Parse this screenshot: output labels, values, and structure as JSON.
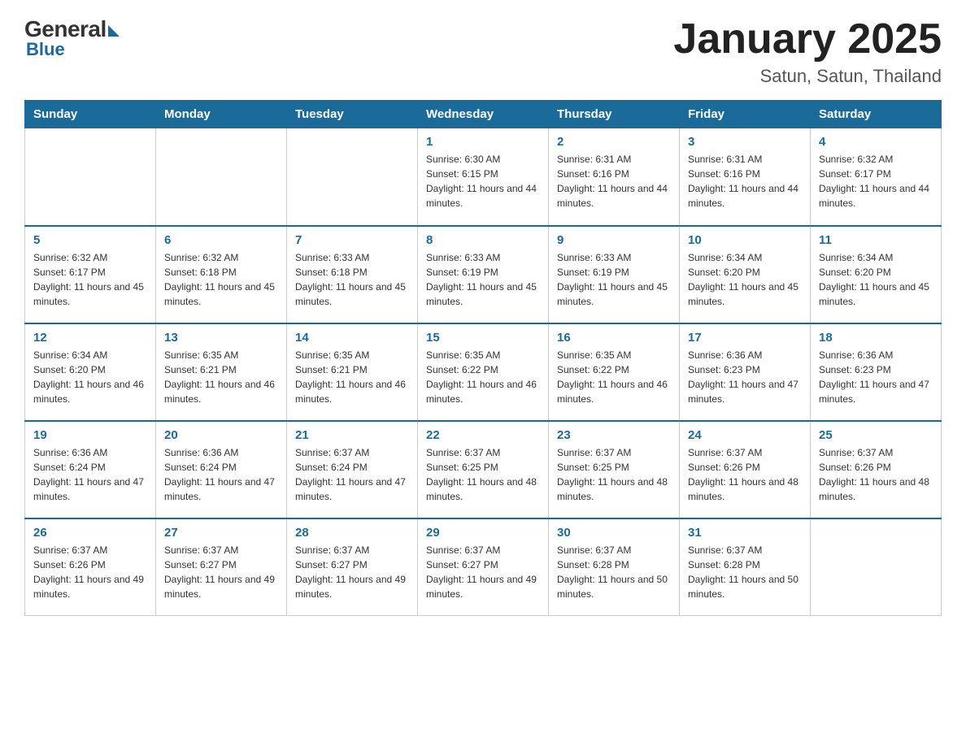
{
  "logo": {
    "general": "General",
    "blue": "Blue"
  },
  "title": "January 2025",
  "subtitle": "Satun, Satun, Thailand",
  "headers": [
    "Sunday",
    "Monday",
    "Tuesday",
    "Wednesday",
    "Thursday",
    "Friday",
    "Saturday"
  ],
  "weeks": [
    [
      {
        "day": "",
        "info": ""
      },
      {
        "day": "",
        "info": ""
      },
      {
        "day": "",
        "info": ""
      },
      {
        "day": "1",
        "info": "Sunrise: 6:30 AM\nSunset: 6:15 PM\nDaylight: 11 hours and 44 minutes."
      },
      {
        "day": "2",
        "info": "Sunrise: 6:31 AM\nSunset: 6:16 PM\nDaylight: 11 hours and 44 minutes."
      },
      {
        "day": "3",
        "info": "Sunrise: 6:31 AM\nSunset: 6:16 PM\nDaylight: 11 hours and 44 minutes."
      },
      {
        "day": "4",
        "info": "Sunrise: 6:32 AM\nSunset: 6:17 PM\nDaylight: 11 hours and 44 minutes."
      }
    ],
    [
      {
        "day": "5",
        "info": "Sunrise: 6:32 AM\nSunset: 6:17 PM\nDaylight: 11 hours and 45 minutes."
      },
      {
        "day": "6",
        "info": "Sunrise: 6:32 AM\nSunset: 6:18 PM\nDaylight: 11 hours and 45 minutes."
      },
      {
        "day": "7",
        "info": "Sunrise: 6:33 AM\nSunset: 6:18 PM\nDaylight: 11 hours and 45 minutes."
      },
      {
        "day": "8",
        "info": "Sunrise: 6:33 AM\nSunset: 6:19 PM\nDaylight: 11 hours and 45 minutes."
      },
      {
        "day": "9",
        "info": "Sunrise: 6:33 AM\nSunset: 6:19 PM\nDaylight: 11 hours and 45 minutes."
      },
      {
        "day": "10",
        "info": "Sunrise: 6:34 AM\nSunset: 6:20 PM\nDaylight: 11 hours and 45 minutes."
      },
      {
        "day": "11",
        "info": "Sunrise: 6:34 AM\nSunset: 6:20 PM\nDaylight: 11 hours and 45 minutes."
      }
    ],
    [
      {
        "day": "12",
        "info": "Sunrise: 6:34 AM\nSunset: 6:20 PM\nDaylight: 11 hours and 46 minutes."
      },
      {
        "day": "13",
        "info": "Sunrise: 6:35 AM\nSunset: 6:21 PM\nDaylight: 11 hours and 46 minutes."
      },
      {
        "day": "14",
        "info": "Sunrise: 6:35 AM\nSunset: 6:21 PM\nDaylight: 11 hours and 46 minutes."
      },
      {
        "day": "15",
        "info": "Sunrise: 6:35 AM\nSunset: 6:22 PM\nDaylight: 11 hours and 46 minutes."
      },
      {
        "day": "16",
        "info": "Sunrise: 6:35 AM\nSunset: 6:22 PM\nDaylight: 11 hours and 46 minutes."
      },
      {
        "day": "17",
        "info": "Sunrise: 6:36 AM\nSunset: 6:23 PM\nDaylight: 11 hours and 47 minutes."
      },
      {
        "day": "18",
        "info": "Sunrise: 6:36 AM\nSunset: 6:23 PM\nDaylight: 11 hours and 47 minutes."
      }
    ],
    [
      {
        "day": "19",
        "info": "Sunrise: 6:36 AM\nSunset: 6:24 PM\nDaylight: 11 hours and 47 minutes."
      },
      {
        "day": "20",
        "info": "Sunrise: 6:36 AM\nSunset: 6:24 PM\nDaylight: 11 hours and 47 minutes."
      },
      {
        "day": "21",
        "info": "Sunrise: 6:37 AM\nSunset: 6:24 PM\nDaylight: 11 hours and 47 minutes."
      },
      {
        "day": "22",
        "info": "Sunrise: 6:37 AM\nSunset: 6:25 PM\nDaylight: 11 hours and 48 minutes."
      },
      {
        "day": "23",
        "info": "Sunrise: 6:37 AM\nSunset: 6:25 PM\nDaylight: 11 hours and 48 minutes."
      },
      {
        "day": "24",
        "info": "Sunrise: 6:37 AM\nSunset: 6:26 PM\nDaylight: 11 hours and 48 minutes."
      },
      {
        "day": "25",
        "info": "Sunrise: 6:37 AM\nSunset: 6:26 PM\nDaylight: 11 hours and 48 minutes."
      }
    ],
    [
      {
        "day": "26",
        "info": "Sunrise: 6:37 AM\nSunset: 6:26 PM\nDaylight: 11 hours and 49 minutes."
      },
      {
        "day": "27",
        "info": "Sunrise: 6:37 AM\nSunset: 6:27 PM\nDaylight: 11 hours and 49 minutes."
      },
      {
        "day": "28",
        "info": "Sunrise: 6:37 AM\nSunset: 6:27 PM\nDaylight: 11 hours and 49 minutes."
      },
      {
        "day": "29",
        "info": "Sunrise: 6:37 AM\nSunset: 6:27 PM\nDaylight: 11 hours and 49 minutes."
      },
      {
        "day": "30",
        "info": "Sunrise: 6:37 AM\nSunset: 6:28 PM\nDaylight: 11 hours and 50 minutes."
      },
      {
        "day": "31",
        "info": "Sunrise: 6:37 AM\nSunset: 6:28 PM\nDaylight: 11 hours and 50 minutes."
      },
      {
        "day": "",
        "info": ""
      }
    ]
  ]
}
